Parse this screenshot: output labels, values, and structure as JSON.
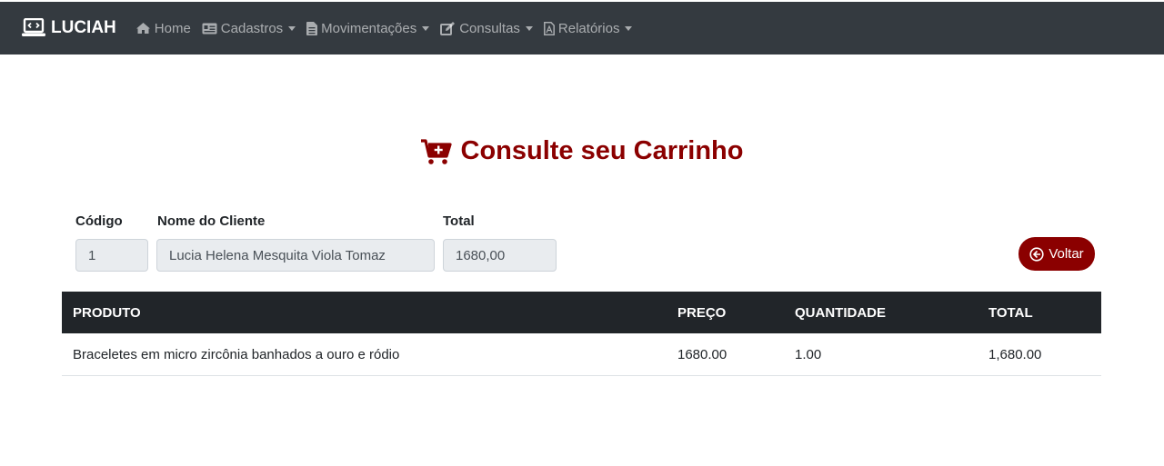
{
  "navbar": {
    "brand": "LUCIAH",
    "items": [
      {
        "label": "Home",
        "icon": "home-icon",
        "dropdown": false
      },
      {
        "label": "Cadastros",
        "icon": "id-card-icon",
        "dropdown": true
      },
      {
        "label": "Movimentações",
        "icon": "file-icon",
        "dropdown": true
      },
      {
        "label": "Consultas",
        "icon": "edit-icon",
        "dropdown": true
      },
      {
        "label": "Relatórios",
        "icon": "pdf-icon",
        "dropdown": true
      }
    ]
  },
  "page": {
    "title": "Consulte seu Carrinho",
    "title_icon": "cart-plus-icon"
  },
  "form": {
    "codigo_label": "Código",
    "codigo_value": "1",
    "cliente_label": "Nome do Cliente",
    "cliente_value": "Lucia Helena Mesquita Viola Tomaz",
    "total_label": "Total",
    "total_value": "1680,00"
  },
  "voltar_button": {
    "label": "Voltar",
    "icon": "arrow-circle-left-icon"
  },
  "table": {
    "headers": [
      "PRODUTO",
      "PREÇO",
      "QUANTIDADE",
      "TOTAL"
    ],
    "rows": [
      [
        "Braceletes em micro zircônia banhados a ouro e ródio",
        "1680.00",
        "1.00",
        "1,680.00"
      ]
    ]
  },
  "colors": {
    "navbar_bg": "#343a40",
    "accent": "#8b0000",
    "table_header_bg": "#212529"
  }
}
